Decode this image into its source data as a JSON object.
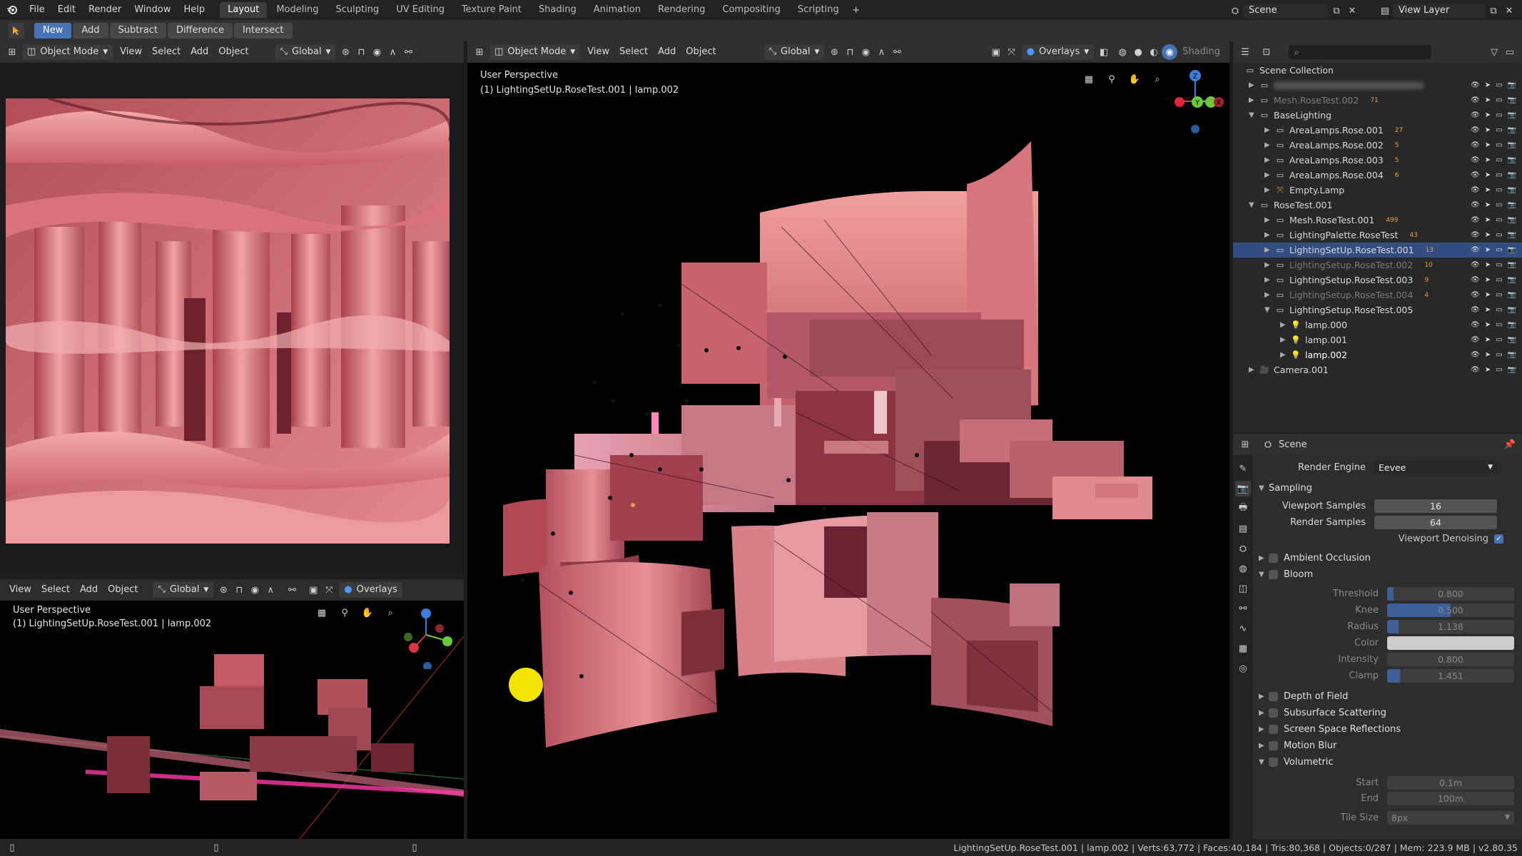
{
  "topbar": {
    "menus": [
      "File",
      "Edit",
      "Render",
      "Window",
      "Help"
    ],
    "workspaces": [
      "Layout",
      "Modeling",
      "Sculpting",
      "UV Editing",
      "Texture Paint",
      "Shading",
      "Animation",
      "Rendering",
      "Compositing",
      "Scripting"
    ],
    "active_workspace": "Layout",
    "scene": "Scene",
    "view_layer": "View Layer"
  },
  "toolheader": {
    "buttons": [
      "New",
      "Add",
      "Subtract",
      "Difference",
      "Intersect"
    ],
    "active": "New"
  },
  "viewport_header": {
    "mode": "Object Mode",
    "menus": [
      "View",
      "Select",
      "Add",
      "Object"
    ],
    "orientation": "Global",
    "overlays": "Overlays",
    "shading": "Shading"
  },
  "viewport_main": {
    "title": "User Perspective",
    "subtitle": "(1) LightingSetUp.RoseTest.001 | lamp.002"
  },
  "viewport_bottom": {
    "menus": [
      "View",
      "Select",
      "Add",
      "Object"
    ],
    "orientation": "Global",
    "overlays": "Overlays",
    "title": "User Perspective",
    "subtitle": "(1) LightingSetUp.RoseTest.001 | lamp.002"
  },
  "gizmo": {
    "x": "X",
    "y": "Y",
    "z": "Z"
  },
  "outliner": {
    "root": "Scene Collection",
    "rows": [
      {
        "indent": 1,
        "label": "",
        "icon": "collection",
        "dim": true,
        "blur": true
      },
      {
        "indent": 1,
        "label": "Mesh.RoseTest.002",
        "icon": "collection",
        "dim": true,
        "badge": "71"
      },
      {
        "indent": 1,
        "label": "BaseLighting",
        "icon": "collection",
        "open": true
      },
      {
        "indent": 2,
        "label": "AreaLamps.Rose.001",
        "icon": "collection",
        "badge": "27"
      },
      {
        "indent": 2,
        "label": "AreaLamps.Rose.002",
        "icon": "collection",
        "badge": "5"
      },
      {
        "indent": 2,
        "label": "AreaLamps.Rose.003",
        "icon": "collection",
        "badge": "5"
      },
      {
        "indent": 2,
        "label": "AreaLamps.Rose.004",
        "icon": "collection",
        "badge": "6"
      },
      {
        "indent": 2,
        "label": "Empty.Lamp",
        "icon": "empty"
      },
      {
        "indent": 1,
        "label": "RoseTest.001",
        "icon": "collection",
        "open": true
      },
      {
        "indent": 2,
        "label": "Mesh.RoseTest.001",
        "icon": "collection",
        "badge": "499"
      },
      {
        "indent": 2,
        "label": "LightingPalette.RoseTest",
        "icon": "collection",
        "badge": "43"
      },
      {
        "indent": 2,
        "label": "LightingSetUp.RoseTest.001",
        "icon": "collection",
        "badge": "13",
        "selected": true
      },
      {
        "indent": 2,
        "label": "LightingSetup.RoseTest.002",
        "icon": "collection",
        "dim": true,
        "badge": "10"
      },
      {
        "indent": 2,
        "label": "LightingSetup.RoseTest.003",
        "icon": "collection",
        "badge": "9"
      },
      {
        "indent": 2,
        "label": "LightingSetup.RoseTest.004",
        "icon": "collection",
        "dim": true,
        "badge": "4"
      },
      {
        "indent": 2,
        "label": "LightingSetup.RoseTest.005",
        "icon": "collection",
        "open": true
      },
      {
        "indent": 3,
        "label": "lamp.000",
        "icon": "lamp"
      },
      {
        "indent": 3,
        "label": "lamp.001",
        "icon": "lamp"
      },
      {
        "indent": 3,
        "label": "lamp.002",
        "icon": "lamp",
        "active": true
      },
      {
        "indent": 1,
        "label": "Camera.001",
        "icon": "camera"
      }
    ]
  },
  "properties": {
    "context": "Scene",
    "render_engine_label": "Render Engine",
    "render_engine": "Eevee",
    "sampling": {
      "title": "Sampling",
      "viewport_samples_label": "Viewport Samples",
      "viewport_samples": "16",
      "render_samples_label": "Render Samples",
      "render_samples": "64",
      "viewport_denoising": "Viewport Denoising"
    },
    "ambient_occlusion": "Ambient Occlusion",
    "bloom": {
      "title": "Bloom",
      "fields": [
        {
          "label": "Threshold",
          "value": "0.800",
          "fill": 0.05
        },
        {
          "label": "Knee",
          "value": "0.500",
          "fill": 0.5
        },
        {
          "label": "Radius",
          "value": "1.138",
          "fill": 0.09
        },
        {
          "label": "Color",
          "value": "",
          "fill": 0,
          "color": "#cccccc"
        },
        {
          "label": "Intensity",
          "value": "0.800",
          "fill": 0
        },
        {
          "label": "Clamp",
          "value": "1.451",
          "fill": 0.1
        }
      ]
    },
    "panels": [
      "Depth of Field",
      "Subsurface Scattering",
      "Screen Space Reflections",
      "Motion Blur"
    ],
    "volumetric": {
      "title": "Volumetric",
      "start_label": "Start",
      "start": "0.1m",
      "end_label": "End",
      "end": "100m",
      "tile_label": "Tile Size",
      "tile": "8px"
    }
  },
  "statusbar": {
    "text": "LightingSetUp.RoseTest.001 | lamp.002 | Verts:63,772 | Faces:40,184 | Tris:80,368 | Objects:0/287 | Mem: 223.9 MB | v2.80.35"
  },
  "colors": {
    "accent": "#4772b3",
    "selection": "#334d80",
    "lamp_yellow": "#f2e400",
    "render_pink": "#e4767f"
  }
}
